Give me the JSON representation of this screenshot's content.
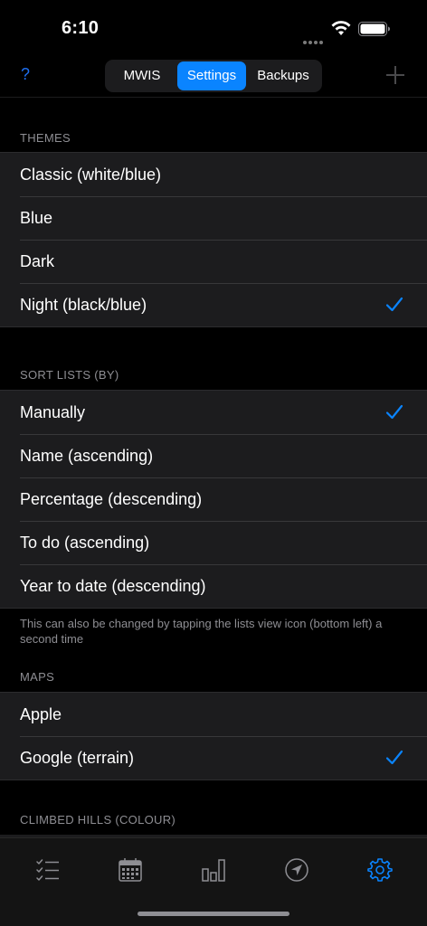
{
  "status_bar": {
    "time": "6:10"
  },
  "nav": {
    "help_label": "?",
    "segments": [
      {
        "label": "MWIS",
        "selected": false
      },
      {
        "label": "Settings",
        "selected": true
      },
      {
        "label": "Backups",
        "selected": false
      }
    ]
  },
  "sections": {
    "themes": {
      "header": "THEMES",
      "items": [
        {
          "label": "Classic (white/blue)",
          "checked": false
        },
        {
          "label": "Blue",
          "checked": false
        },
        {
          "label": "Dark",
          "checked": false
        },
        {
          "label": "Night (black/blue)",
          "checked": true
        }
      ]
    },
    "sort_lists": {
      "header": "SORT LISTS (BY)",
      "items": [
        {
          "label": "Manually",
          "checked": true
        },
        {
          "label": "Name (ascending)",
          "checked": false
        },
        {
          "label": "Percentage (descending)",
          "checked": false
        },
        {
          "label": "To do (ascending)",
          "checked": false
        },
        {
          "label": "Year to date (descending)",
          "checked": false
        }
      ],
      "footer": "This can also be changed by tapping the lists view icon (bottom left) a second time"
    },
    "maps": {
      "header": "MAPS",
      "items": [
        {
          "label": "Apple",
          "checked": false
        },
        {
          "label": "Google (terrain)",
          "checked": true
        }
      ]
    },
    "climbed_hills": {
      "header": "CLIMBED HILLS (COLOUR)"
    }
  },
  "tab_bar": {
    "tabs": [
      {
        "icon": "checklist-icon",
        "selected": false
      },
      {
        "icon": "calendar-icon",
        "selected": false
      },
      {
        "icon": "bar-chart-icon",
        "selected": false
      },
      {
        "icon": "location-arrow-icon",
        "selected": false
      },
      {
        "icon": "gear-icon",
        "selected": true
      }
    ]
  },
  "colors": {
    "accent": "#0a84ff",
    "background": "#000000",
    "cell": "#1c1c1e",
    "secondary_text": "#8e8e93"
  }
}
